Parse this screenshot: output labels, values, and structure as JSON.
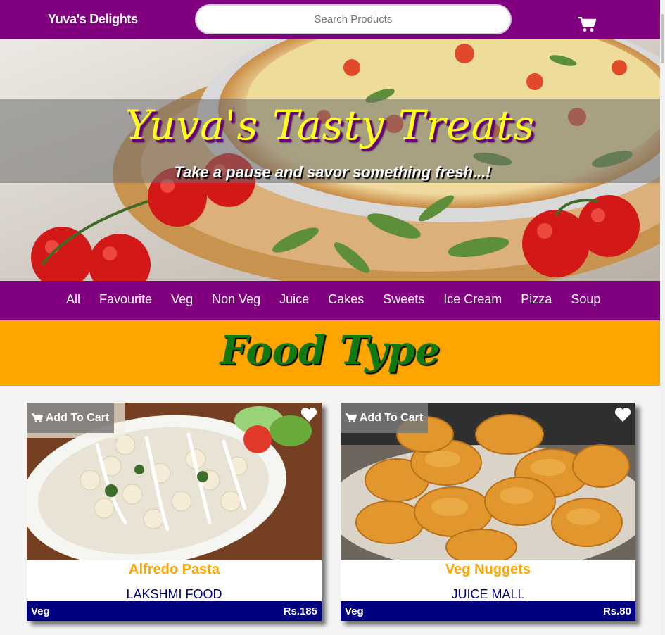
{
  "header": {
    "brand": "Yuva's Delights",
    "search_placeholder": "Search Products",
    "cart_icon": "shopping-cart-icon"
  },
  "hero": {
    "title": "Yuva's Tasty Treats",
    "subtitle": "Take a pause and savor something fresh...!"
  },
  "categories": [
    "All",
    "Favourite",
    "Veg",
    "Non Veg",
    "Juice",
    "Cakes",
    "Sweets",
    "Ice Cream",
    "Pizza",
    "Soup"
  ],
  "section_title": "Food Type",
  "products": [
    {
      "add_label": "Add To Cart",
      "name": "Alfredo Pasta",
      "shop": "LAKSHMI FOOD",
      "type": "Veg",
      "price": "Rs.185",
      "heart_icon": "heart-icon"
    },
    {
      "add_label": "Add To Cart",
      "name": "Veg Nuggets",
      "shop": "JUICE MALL",
      "type": "Veg",
      "price": "Rs.80",
      "heart_icon": "heart-icon"
    }
  ],
  "colors": {
    "primary": "#800080",
    "accent": "#ffa500",
    "footer": "#000080",
    "title_green": "#107a10",
    "hero_title": "#ffff1a"
  }
}
